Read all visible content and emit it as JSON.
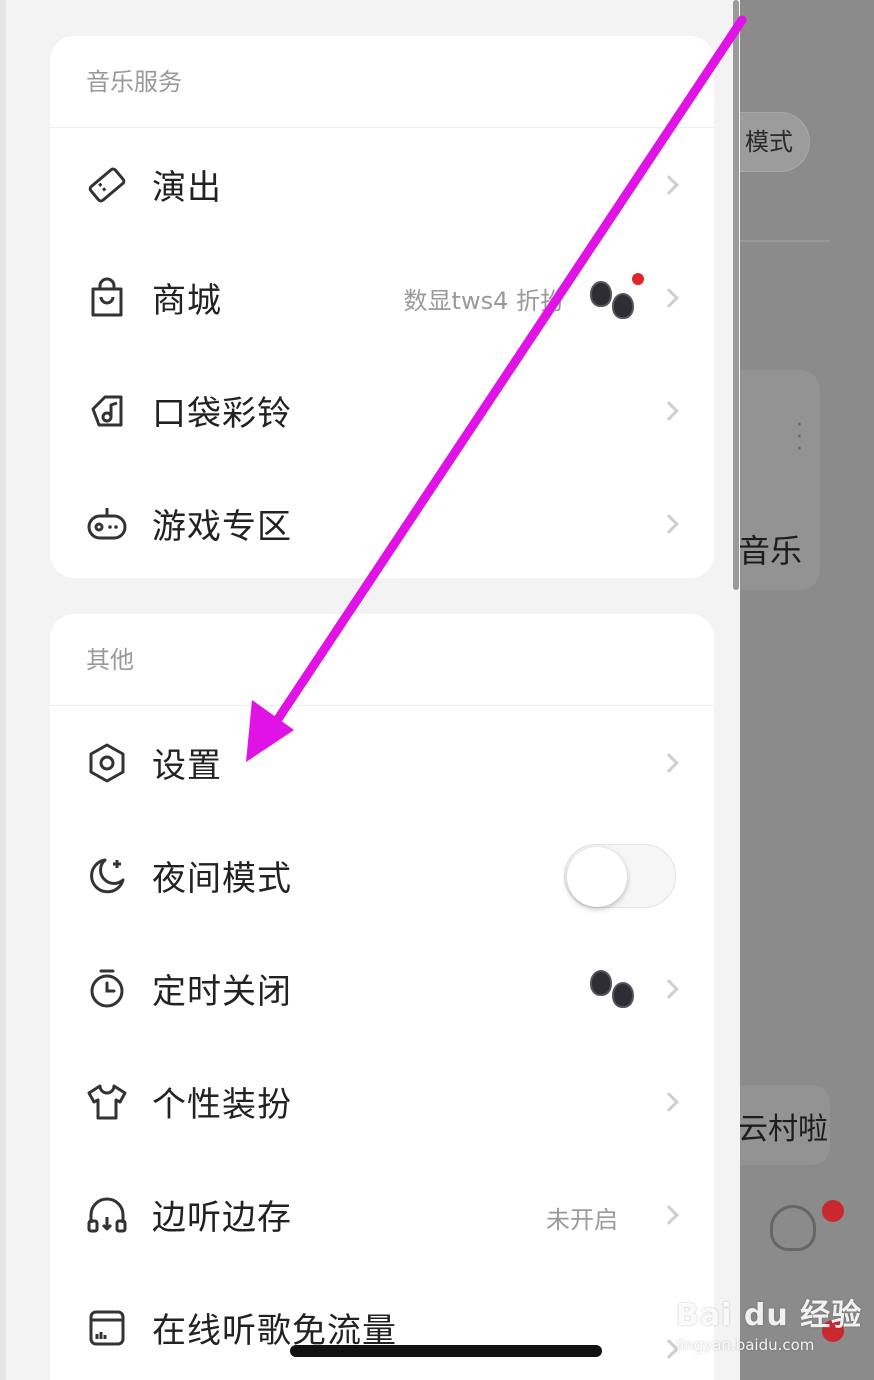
{
  "overlay": {
    "chip_label": "模式",
    "text1": "音乐",
    "text2": "云村啦"
  },
  "sections": [
    {
      "title": "音乐服务",
      "items": [
        {
          "label": "演出",
          "icon": "ticket-icon"
        },
        {
          "label": "商城",
          "icon": "shopping-bag-icon",
          "subtitle": "数显tws4 折扮"
        },
        {
          "label": "口袋彩铃",
          "icon": "music-note-icon"
        },
        {
          "label": "游戏专区",
          "icon": "gamepad-icon"
        }
      ]
    },
    {
      "title": "其他",
      "items": [
        {
          "label": "设置",
          "icon": "settings-hexagon-icon"
        },
        {
          "label": "夜间模式",
          "icon": "moon-icon",
          "toggle": false
        },
        {
          "label": "定时关闭",
          "icon": "timer-icon"
        },
        {
          "label": "个性装扮",
          "icon": "tshirt-icon"
        },
        {
          "label": "边听边存",
          "icon": "headphones-icon",
          "subtitle": "未开启"
        },
        {
          "label": "在线听歌免流量",
          "icon": "sim-card-icon"
        }
      ]
    }
  ],
  "watermark": {
    "main": "Bai du 经验",
    "sub": "jingyan.baidu.com"
  },
  "colors": {
    "annotation_arrow": "#e012e6",
    "notification_dot": "#e0262c"
  }
}
